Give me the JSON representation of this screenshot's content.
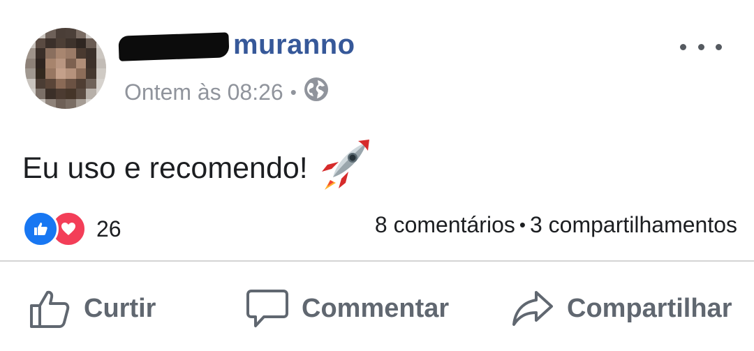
{
  "post": {
    "author_name": "muranno",
    "timestamp": "Ontem às 08:26",
    "separator": "•",
    "text": "Eu uso e recomendo!",
    "emoji": "rocket"
  },
  "stats": {
    "reaction_count": "26",
    "reactions": [
      "like",
      "love"
    ],
    "comments": "8 comentários",
    "separator": "•",
    "shares": "3 compartilhamentos"
  },
  "actions": {
    "like_label": "Curtir",
    "comment_label": "Commentar",
    "share_label": "Compartilhar"
  },
  "colors": {
    "author": "#365899",
    "muted": "#90949c",
    "action": "#606770",
    "like": "#1877f2",
    "love": "#f33e58"
  },
  "icons": [
    "more-icon",
    "globe-icon",
    "rocket-icon",
    "like-icon",
    "heart-icon",
    "thumbs-up-icon",
    "speech-bubble-icon",
    "share-arrow-icon"
  ]
}
